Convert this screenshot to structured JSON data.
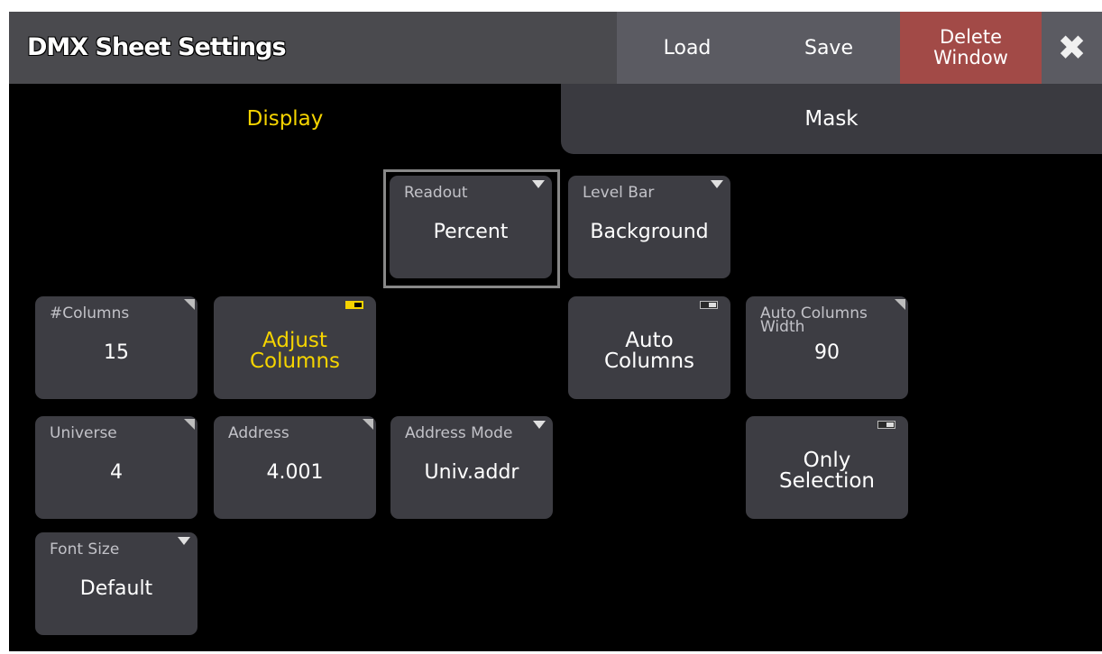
{
  "titlebar": {
    "title": "DMX Sheet Settings",
    "load_label": "Load",
    "save_label": "Save",
    "delete_label": "Delete\nWindow",
    "close_icon": "close-x-icon"
  },
  "tabs": [
    {
      "label": "Display",
      "active": true
    },
    {
      "label": "Mask",
      "active": false
    }
  ],
  "settings": {
    "readout": {
      "label": "Readout",
      "value": "Percent"
    },
    "level_bar": {
      "label": "Level Bar",
      "value": "Background"
    },
    "columns": {
      "label": "#Columns",
      "value": "15"
    },
    "adjust_columns": {
      "label": "Adjust\nColumns",
      "on": true
    },
    "auto_columns": {
      "label": "Auto\nColumns",
      "on": false
    },
    "auto_columns_width": {
      "label": "Auto Columns\nWidth",
      "value": "90"
    },
    "universe": {
      "label": "Universe",
      "value": "4"
    },
    "address": {
      "label": "Address",
      "value": "4.001"
    },
    "address_mode": {
      "label": "Address Mode",
      "value": "Univ.addr"
    },
    "only_selection": {
      "label": "Only\nSelection",
      "on": false
    },
    "font_size": {
      "label": "Font Size",
      "value": "Default"
    }
  },
  "colors": {
    "accent": "#f5d400",
    "delete": "#a24a47",
    "button": "#3d3d43"
  }
}
